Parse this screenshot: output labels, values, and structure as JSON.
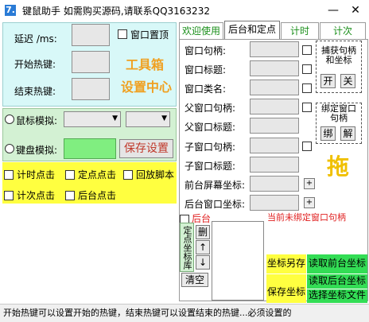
{
  "window": {
    "icon_text": "7.",
    "title": "键鼠助手    如需购买源码,请联系QQ3163232",
    "minimize": "—",
    "close": "✕"
  },
  "left": {
    "delay_label": "延迟 /ms:",
    "start_hotkey_label": "开始热键:",
    "end_hotkey_label": "结束热键:",
    "window_top_label": "窗口置顶",
    "toolbox_text": "工具箱",
    "settings_center_text": "设置中心",
    "mouse_sim_label": "鼠标模拟:",
    "keyboard_sim_label": "键盘模拟:",
    "save_settings": "保存设置",
    "modes": [
      "计时点击",
      "定点点击",
      "回放脚本",
      "计次点击",
      "后台点击"
    ]
  },
  "tabs": [
    {
      "label": "欢迎使用",
      "color": "green"
    },
    {
      "label": "后台和定点",
      "color": "black"
    },
    {
      "label": "计时",
      "color": "green"
    },
    {
      "label": "计次",
      "color": "green"
    }
  ],
  "right": {
    "fields": [
      "窗口句柄:",
      "窗口标题:",
      "窗口类名:",
      "父窗口句柄:",
      "父窗口标题:",
      "子窗口句柄:",
      "子窗口标题:",
      "前台屏幕坐标:",
      "后台窗口坐标:"
    ],
    "capture_title": "捕获句柄和坐标",
    "capture_open": "开",
    "capture_close": "关",
    "bind_title": "绑定窗口句柄",
    "bind_btn": "绑",
    "unbind_btn": "解",
    "drag_text": "拖",
    "plus": "+",
    "background_label": "后台",
    "unbound_warning": "当前未绑定窗口句柄",
    "fixed_coords_label": "定点坐标库",
    "delete_btn": "删",
    "up_btn": "↑",
    "down_btn": "↓",
    "clear_btn": "清空",
    "save_coord": "坐标另存",
    "read_front": "读取前台坐标",
    "read_back": "读取后台坐标",
    "save_coord2": "保存坐标",
    "read_file": "选择坐标文件"
  },
  "status": {
    "text": "开始热键可以设置开始的热键，结束热键可以设置结束的热键...必须设置的"
  },
  "colors": {
    "cyan_panel": "#d8f8f8",
    "green_panel": "#d3f1d3",
    "yellow_panel": "#ffff40",
    "orange_text": "#f0a020",
    "red_text": "#e02020",
    "green_button": "#33dd55"
  }
}
